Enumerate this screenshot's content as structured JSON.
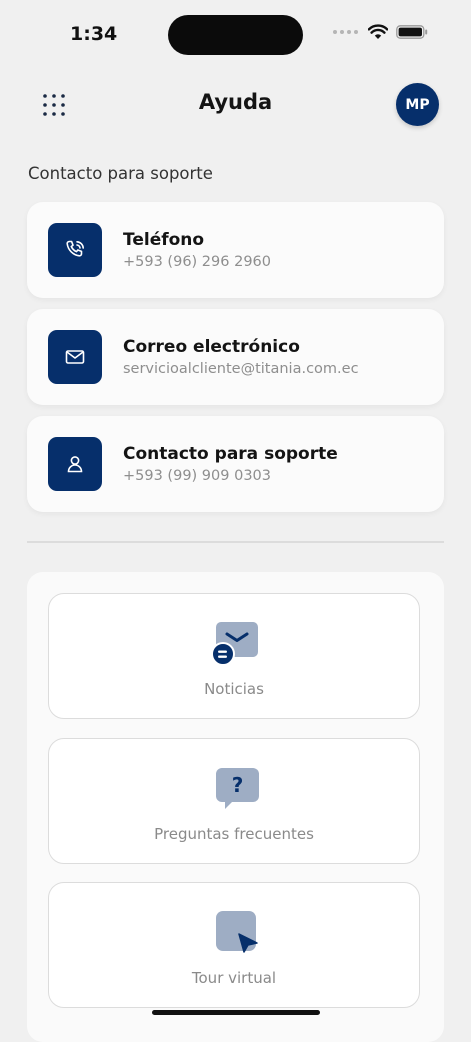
{
  "status_bar": {
    "time": "1:34"
  },
  "header": {
    "title": "Ayuda",
    "avatar_initials": "MP"
  },
  "contact_section": {
    "title": "Contacto para soporte",
    "items": [
      {
        "label": "Teléfono",
        "value": "+593 (96) 296 2960",
        "icon": "phone-icon"
      },
      {
        "label": "Correo electrónico",
        "value": "servicioalcliente@titania.com.ec",
        "icon": "mail-icon"
      },
      {
        "label": "Contacto para soporte",
        "value": "+593 (99) 909 0303",
        "icon": "user-icon"
      }
    ]
  },
  "menu": {
    "items": [
      {
        "label": "Noticias",
        "icon": "news-icon"
      },
      {
        "label": "Preguntas frecuentes",
        "icon": "question-bubble-icon"
      },
      {
        "label": "Tour virtual",
        "icon": "cursor-pointer-icon"
      }
    ]
  },
  "colors": {
    "primary": "#062f6b",
    "icon_light": "#9eadc4",
    "background": "#f0f0f0"
  }
}
